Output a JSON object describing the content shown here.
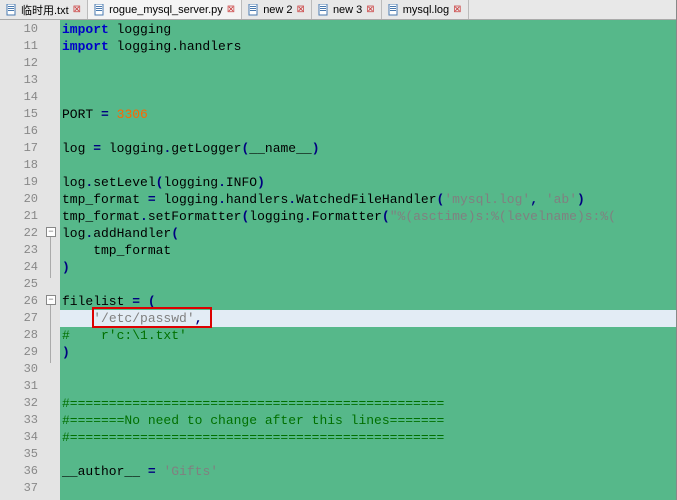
{
  "tabs": [
    {
      "label": "临时用.txt",
      "active": false
    },
    {
      "label": "rogue_mysql_server.py",
      "active": true
    },
    {
      "label": "new 2",
      "active": false
    },
    {
      "label": "new 3",
      "active": false
    },
    {
      "label": "mysql.log",
      "active": false
    }
  ],
  "lines": {
    "10": {
      "type": "import",
      "kw": "import",
      "rest": " logging"
    },
    "11": {
      "type": "import",
      "kw": "import",
      "rest": " logging.handlers"
    },
    "12": {
      "type": "blank"
    },
    "13": {
      "type": "blank"
    },
    "14": {
      "type": "blank"
    },
    "15": {
      "type": "assign",
      "text_before": "PORT ",
      "op": "=",
      "text_after": " ",
      "num": "3306"
    },
    "16": {
      "type": "blank"
    },
    "17": {
      "type": "code",
      "parts": [
        [
          "ident",
          "log "
        ],
        [
          "op",
          "="
        ],
        [
          "ident",
          " logging"
        ],
        [
          "op",
          "."
        ],
        [
          "ident",
          "getLogger"
        ],
        [
          "op",
          "("
        ],
        [
          "ident",
          "__name__"
        ],
        [
          "op",
          ")"
        ]
      ]
    },
    "18": {
      "type": "blank"
    },
    "19": {
      "type": "code",
      "parts": [
        [
          "ident",
          "log"
        ],
        [
          "op",
          "."
        ],
        [
          "ident",
          "setLevel"
        ],
        [
          "op",
          "("
        ],
        [
          "ident",
          "logging"
        ],
        [
          "op",
          "."
        ],
        [
          "ident",
          "INFO"
        ],
        [
          "op",
          ")"
        ]
      ]
    },
    "20": {
      "type": "code",
      "parts": [
        [
          "ident",
          "tmp_format "
        ],
        [
          "op",
          "="
        ],
        [
          "ident",
          " logging"
        ],
        [
          "op",
          "."
        ],
        [
          "ident",
          "handlers"
        ],
        [
          "op",
          "."
        ],
        [
          "ident",
          "WatchedFileHandler"
        ],
        [
          "op",
          "("
        ],
        [
          "str",
          "'mysql.log'"
        ],
        [
          "op",
          ","
        ],
        [
          "ident",
          " "
        ],
        [
          "str",
          "'ab'"
        ],
        [
          "op",
          ")"
        ]
      ]
    },
    "21": {
      "type": "code",
      "parts": [
        [
          "ident",
          "tmp_format"
        ],
        [
          "op",
          "."
        ],
        [
          "ident",
          "setFormatter"
        ],
        [
          "op",
          "("
        ],
        [
          "ident",
          "logging"
        ],
        [
          "op",
          "."
        ],
        [
          "ident",
          "Formatter"
        ],
        [
          "op",
          "("
        ],
        [
          "str",
          "\"%(asctime)s:%(levelname)s:%("
        ]
      ]
    },
    "22": {
      "type": "code",
      "parts": [
        [
          "ident",
          "log"
        ],
        [
          "op",
          "."
        ],
        [
          "ident",
          "addHandler"
        ],
        [
          "op",
          "("
        ]
      ]
    },
    "23": {
      "type": "code",
      "parts": [
        [
          "ident",
          "    tmp_format"
        ]
      ]
    },
    "24": {
      "type": "code",
      "parts": [
        [
          "op",
          ")"
        ]
      ]
    },
    "25": {
      "type": "blank"
    },
    "26": {
      "type": "code",
      "parts": [
        [
          "ident",
          "filelist "
        ],
        [
          "op",
          "="
        ],
        [
          "ident",
          " "
        ],
        [
          "op",
          "("
        ]
      ]
    },
    "27": {
      "type": "code",
      "current": true,
      "parts": [
        [
          "ident",
          "    "
        ],
        [
          "str",
          "'/etc/passwd'"
        ],
        [
          "op",
          ","
        ]
      ]
    },
    "28": {
      "type": "code",
      "parts": [
        [
          "cmt",
          "#    r'c:\\1.txt'"
        ]
      ]
    },
    "29": {
      "type": "code",
      "parts": [
        [
          "op",
          ")"
        ]
      ]
    },
    "30": {
      "type": "blank"
    },
    "31": {
      "type": "blank"
    },
    "32": {
      "type": "code",
      "parts": [
        [
          "cmt",
          "#================================================"
        ]
      ]
    },
    "33": {
      "type": "code",
      "parts": [
        [
          "cmt",
          "#=======No need to change after this lines======="
        ]
      ]
    },
    "34": {
      "type": "code",
      "parts": [
        [
          "cmt",
          "#================================================"
        ]
      ]
    },
    "35": {
      "type": "blank"
    },
    "36": {
      "type": "code",
      "parts": [
        [
          "ident",
          "__author__ "
        ],
        [
          "op",
          "="
        ],
        [
          "ident",
          " "
        ],
        [
          "str",
          "'Gifts'"
        ]
      ]
    },
    "37": {
      "type": "blank"
    }
  },
  "first_line": 10,
  "last_line": 37,
  "highlight": {
    "top_line": 27,
    "left_col": 4,
    "width_chars": 14
  }
}
